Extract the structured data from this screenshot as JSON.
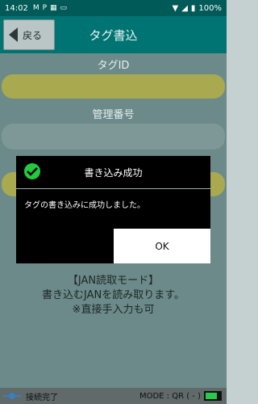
{
  "status_bar": {
    "time": "14:02",
    "icons": [
      "gmail-icon",
      "p-icon",
      "calendar-icon",
      "card-icon",
      "wifi-icon",
      "signal-icon",
      "battery-icon"
    ],
    "battery": "100%"
  },
  "app_bar": {
    "back_label": "戻る",
    "title": "タグ書込"
  },
  "form": {
    "tag_id_label": "タグID",
    "mgmt_label": "管理番号",
    "tag_id_value": "",
    "mgmt_value": ""
  },
  "info": {
    "line1": "【JAN読取モード】",
    "line2": "書き込むJANを読み取ります。",
    "line3": "※直接手入力も可"
  },
  "bottom_bar": {
    "connection": "接続完了",
    "mode": "MODE : QR ( - )",
    "battery_level": 0.8
  },
  "dialog": {
    "title": "書き込み成功",
    "message": "タグの書き込みに成功しました。",
    "ok_label": "OK"
  },
  "colors": {
    "header": "#007473",
    "accent_yellow": "#a9a94f",
    "success": "#23c93f"
  }
}
